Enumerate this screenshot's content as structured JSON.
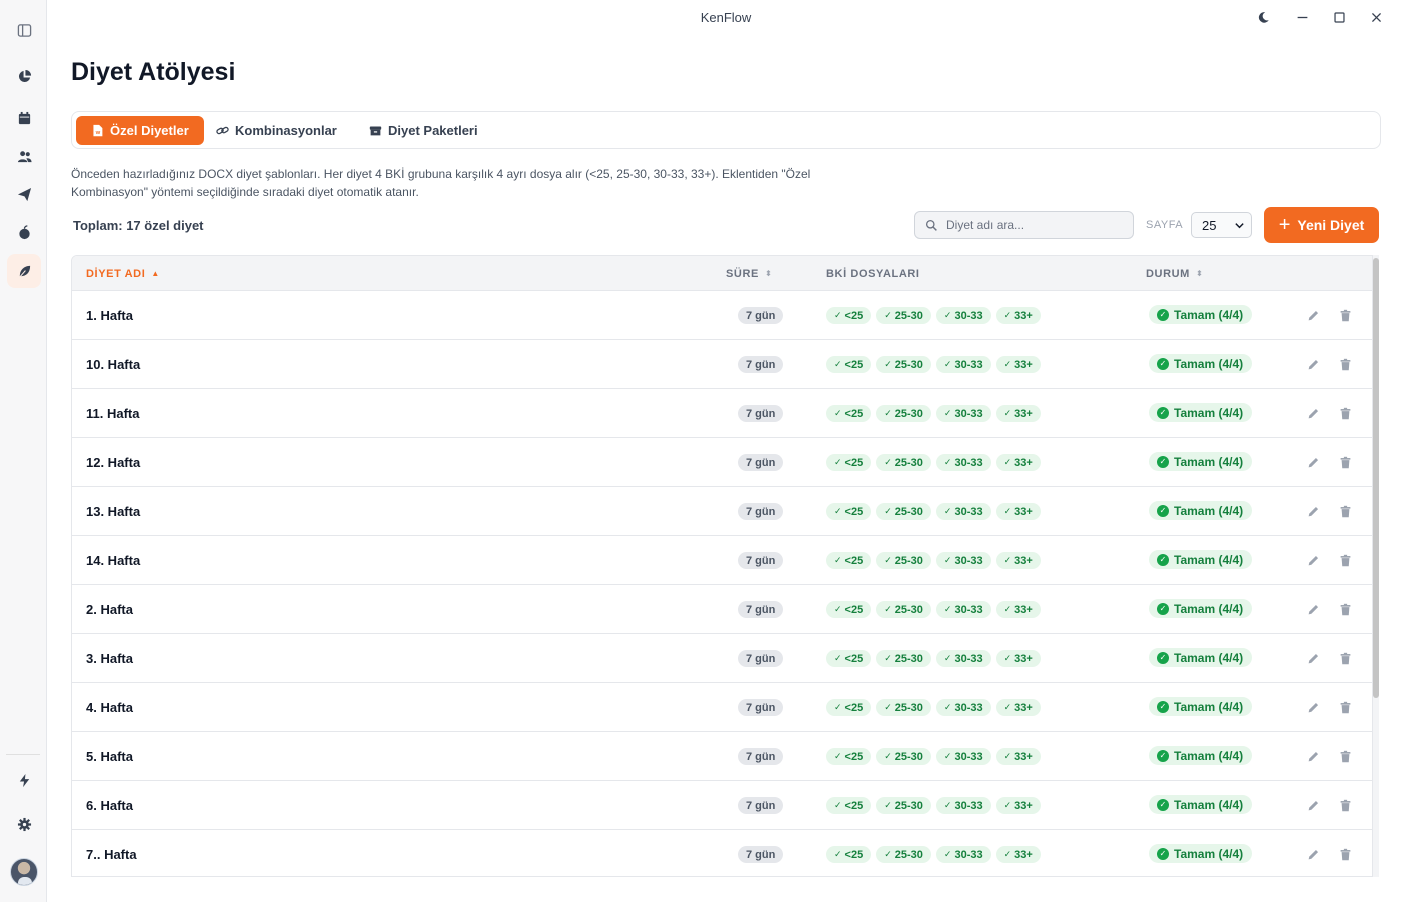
{
  "app": {
    "title": "KenFlow"
  },
  "page": {
    "title": "Diyet Atölyesi",
    "description": "Önceden hazırladığınız DOCX diyet şablonları. Her diyet 4 BKİ grubuna karşılık 4 ayrı dosya alır (<25, 25-30, 30-33, 33+). Eklentiden \"Özel Kombinasyon\" yöntemi seçildiğinde sıradaki diyet otomatik atanır."
  },
  "tabs": [
    {
      "label": "Özel Diyetler",
      "icon": "docx-file-icon",
      "active": true
    },
    {
      "label": "Kombinasyonlar",
      "icon": "link-icon",
      "active": false
    },
    {
      "label": "Diyet Paketleri",
      "icon": "box-icon",
      "active": false
    }
  ],
  "toolbar": {
    "total": "Toplam: 17 özel diyet",
    "search_placeholder": "Diyet adı ara...",
    "page_label": "SAYFA",
    "page_size": "25",
    "new_button": "Yeni Diyet"
  },
  "table": {
    "headers": {
      "name": "DİYET ADI",
      "duration": "SÜRE",
      "bki": "BKİ DOSYALARI",
      "status": "DURUM"
    },
    "rows": [
      {
        "name": "1. Hafta",
        "duration": "7 gün",
        "bki": [
          "<25",
          "25-30",
          "30-33",
          "33+"
        ],
        "status": "Tamam (4/4)"
      },
      {
        "name": "10. Hafta",
        "duration": "7 gün",
        "bki": [
          "<25",
          "25-30",
          "30-33",
          "33+"
        ],
        "status": "Tamam (4/4)"
      },
      {
        "name": "11. Hafta",
        "duration": "7 gün",
        "bki": [
          "<25",
          "25-30",
          "30-33",
          "33+"
        ],
        "status": "Tamam (4/4)"
      },
      {
        "name": "12. Hafta",
        "duration": "7 gün",
        "bki": [
          "<25",
          "25-30",
          "30-33",
          "33+"
        ],
        "status": "Tamam (4/4)"
      },
      {
        "name": "13. Hafta",
        "duration": "7 gün",
        "bki": [
          "<25",
          "25-30",
          "30-33",
          "33+"
        ],
        "status": "Tamam (4/4)"
      },
      {
        "name": "14. Hafta",
        "duration": "7 gün",
        "bki": [
          "<25",
          "25-30",
          "30-33",
          "33+"
        ],
        "status": "Tamam (4/4)"
      },
      {
        "name": "2. Hafta",
        "duration": "7 gün",
        "bki": [
          "<25",
          "25-30",
          "30-33",
          "33+"
        ],
        "status": "Tamam (4/4)"
      },
      {
        "name": "3. Hafta",
        "duration": "7 gün",
        "bki": [
          "<25",
          "25-30",
          "30-33",
          "33+"
        ],
        "status": "Tamam (4/4)"
      },
      {
        "name": "4. Hafta",
        "duration": "7 gün",
        "bki": [
          "<25",
          "25-30",
          "30-33",
          "33+"
        ],
        "status": "Tamam (4/4)"
      },
      {
        "name": "5. Hafta",
        "duration": "7 gün",
        "bki": [
          "<25",
          "25-30",
          "30-33",
          "33+"
        ],
        "status": "Tamam (4/4)"
      },
      {
        "name": "6. Hafta",
        "duration": "7 gün",
        "bki": [
          "<25",
          "25-30",
          "30-33",
          "33+"
        ],
        "status": "Tamam (4/4)"
      },
      {
        "name": "7.. Hafta",
        "duration": "7 gün",
        "bki": [
          "<25",
          "25-30",
          "30-33",
          "33+"
        ],
        "status": "Tamam (4/4)"
      }
    ]
  },
  "sidebar": {
    "items": [
      {
        "icon": "sidebar-toggle-icon"
      },
      {
        "icon": "pie-chart-icon"
      },
      {
        "icon": "calendar-icon"
      },
      {
        "icon": "users-icon"
      },
      {
        "icon": "send-icon"
      },
      {
        "icon": "apple-icon"
      },
      {
        "icon": "leaf-icon",
        "active": true
      },
      {
        "icon": "lightning-icon"
      },
      {
        "icon": "gear-icon"
      }
    ]
  },
  "colors": {
    "accent": "#f26a21",
    "success": "#16a34a",
    "success_bg": "#e6f6ea"
  }
}
